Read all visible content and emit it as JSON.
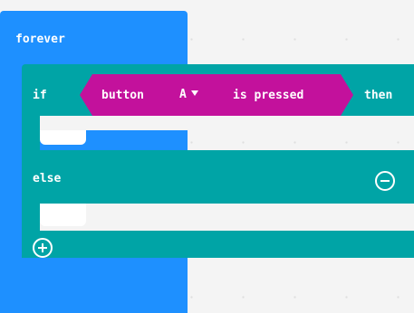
{
  "forever": {
    "label": "forever"
  },
  "if_block": {
    "if_label": "if",
    "then_label": "then",
    "condition": {
      "prefix_label": "button",
      "selected_button": "A",
      "suffix_label": "is pressed"
    }
  },
  "else_block": {
    "label": "else"
  },
  "controls": {
    "remove_icon": "minus-circle-icon",
    "add_icon": "plus-circle-icon"
  },
  "colors": {
    "forever": "#1e90ff",
    "logic": "#00a4a6",
    "input": "#c3119c",
    "canvas": "#f4f4f4"
  }
}
